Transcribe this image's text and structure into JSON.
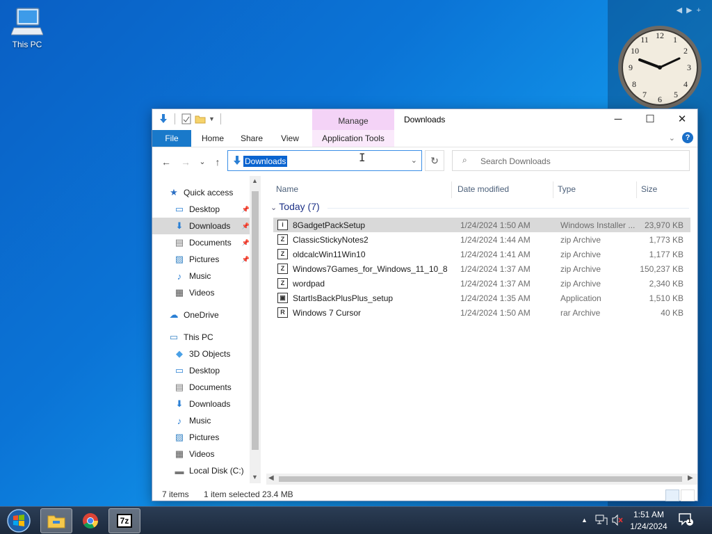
{
  "desktop": {
    "icon_label": "This PC",
    "gadget_nav": "◀▶+"
  },
  "window": {
    "title": "Downloads",
    "context_tab_group": "Manage",
    "ribbon_tabs": [
      "File",
      "Home",
      "Share",
      "View",
      "Application Tools"
    ],
    "controls": [
      "─",
      "☐",
      "✕"
    ]
  },
  "navbar": {
    "back": "←",
    "forward": "→",
    "recent": "⌄",
    "up": "↑",
    "address": "Downloads",
    "search_placeholder": "Search Downloads"
  },
  "navpane": {
    "items": [
      {
        "label": "Quick access",
        "icon": "star-icon",
        "level": 0,
        "pinned": false
      },
      {
        "label": "Desktop",
        "icon": "desktop-icon",
        "level": 1,
        "pinned": true
      },
      {
        "label": "Downloads",
        "icon": "download-icon",
        "level": 1,
        "pinned": true,
        "active": true
      },
      {
        "label": "Documents",
        "icon": "document-icon",
        "level": 1,
        "pinned": true
      },
      {
        "label": "Pictures",
        "icon": "pictures-icon",
        "level": 1,
        "pinned": true
      },
      {
        "label": "Music",
        "icon": "music-icon",
        "level": 1,
        "pinned": false
      },
      {
        "label": "Videos",
        "icon": "videos-icon",
        "level": 1,
        "pinned": false
      },
      {
        "label": "OneDrive",
        "icon": "cloud-icon",
        "level": 0,
        "pinned": false
      },
      {
        "label": "This PC",
        "icon": "computer-icon",
        "level": 0,
        "pinned": false
      },
      {
        "label": "3D Objects",
        "icon": "cube-icon",
        "level": 1,
        "pinned": false
      },
      {
        "label": "Desktop",
        "icon": "desktop-icon",
        "level": 1,
        "pinned": false
      },
      {
        "label": "Documents",
        "icon": "document-icon",
        "level": 1,
        "pinned": false
      },
      {
        "label": "Downloads",
        "icon": "download-icon",
        "level": 1,
        "pinned": false
      },
      {
        "label": "Music",
        "icon": "music-icon",
        "level": 1,
        "pinned": false
      },
      {
        "label": "Pictures",
        "icon": "pictures-icon",
        "level": 1,
        "pinned": false
      },
      {
        "label": "Videos",
        "icon": "videos-icon",
        "level": 1,
        "pinned": false
      },
      {
        "label": "Local Disk (C:)",
        "icon": "drive-icon",
        "level": 1,
        "pinned": false
      }
    ]
  },
  "columns": {
    "name": "Name",
    "date": "Date modified",
    "type": "Type",
    "size": "Size"
  },
  "group": {
    "label": "Today (7)"
  },
  "files": [
    {
      "name": "8GadgetPackSetup",
      "date": "1/24/2024 1:50 AM",
      "type": "Windows Installer ...",
      "size": "23,970 KB",
      "icon": "installer-icon",
      "badge": "i",
      "selected": true
    },
    {
      "name": "ClassicStickyNotes2",
      "date": "1/24/2024 1:44 AM",
      "type": "zip Archive",
      "size": "1,773 KB",
      "icon": "zip-icon",
      "badge": "Z"
    },
    {
      "name": "oldcalcWin11Win10",
      "date": "1/24/2024 1:41 AM",
      "type": "zip Archive",
      "size": "1,177 KB",
      "icon": "zip-icon",
      "badge": "Z"
    },
    {
      "name": "Windows7Games_for_Windows_11_10_8",
      "date": "1/24/2024 1:37 AM",
      "type": "zip Archive",
      "size": "150,237 KB",
      "icon": "zip-icon",
      "badge": "Z"
    },
    {
      "name": "wordpad",
      "date": "1/24/2024 1:37 AM",
      "type": "zip Archive",
      "size": "2,340 KB",
      "icon": "zip-icon",
      "badge": "Z"
    },
    {
      "name": "StartIsBackPlusPlus_setup",
      "date": "1/24/2024 1:35 AM",
      "type": "Application",
      "size": "1,510 KB",
      "icon": "application-icon",
      "badge": "▣"
    },
    {
      "name": "Windows 7 Cursor",
      "date": "1/24/2024 1:50 AM",
      "type": "rar Archive",
      "size": "40 KB",
      "icon": "rar-icon",
      "badge": "R"
    }
  ],
  "status": {
    "count": "7 items",
    "selection": "1 item selected",
    "size": "23.4 MB"
  },
  "taskbar": {
    "time": "1:51 AM",
    "date": "1/24/2024",
    "notification_count": "1",
    "apps": [
      "file-explorer-icon",
      "chrome-icon",
      "7zip-icon"
    ],
    "seven_zip_label": "7z"
  },
  "colors": {
    "accent": "#1979ca",
    "selection": "#cce8ff",
    "context_tab": "#f4d3f7",
    "group_header": "#1e3287"
  }
}
